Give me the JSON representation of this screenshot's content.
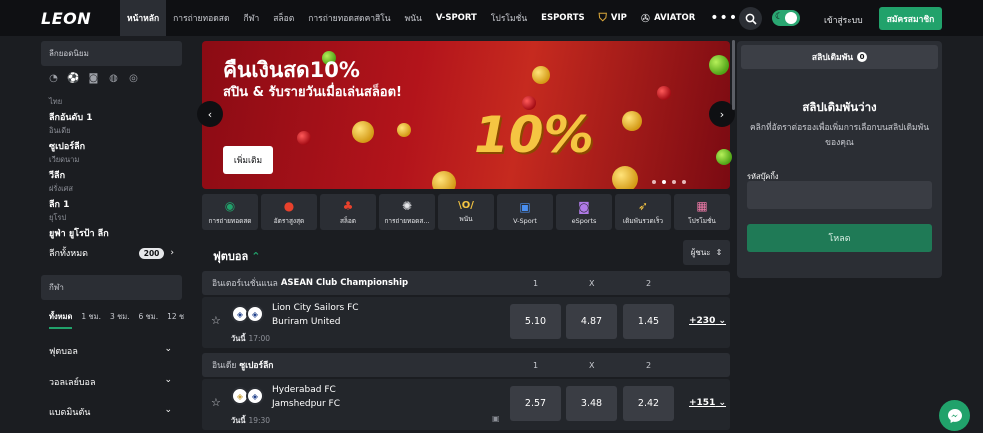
{
  "brand": {
    "logo": "LEON",
    "accent": "#21a26b"
  },
  "nav": {
    "items": [
      {
        "label": "หน้าหลัก"
      },
      {
        "label": "การถ่ายทอดสด"
      },
      {
        "label": "กีฬา"
      },
      {
        "label": "สล็อต"
      },
      {
        "label": "การถ่ายทอดสดคาสิโน"
      },
      {
        "label": "พนัน"
      },
      {
        "label": "V-SPORT"
      },
      {
        "label": "โปรโมชั่น"
      },
      {
        "label": "ESPORTS"
      },
      {
        "label": "VIP"
      },
      {
        "label": "AVIATOR"
      }
    ],
    "login": "เข้าสู่ระบบ",
    "signup": "สมัครสมาชิก"
  },
  "sidebar": {
    "popular_title": "ลีกยอดนิยม",
    "leagues": [
      {
        "country": "ไทย",
        "name": "ลีกอันดับ 1"
      },
      {
        "country": "อินเดีย",
        "name": "ซูเปอร์ลีก"
      },
      {
        "country": "เวียดนาม",
        "name": "วีลีก"
      },
      {
        "country": "ฝรั่งเศส",
        "name": "ลีก 1"
      },
      {
        "country": "ยุโรป",
        "name": "ยูฟ่า ยูโรป้า ลีก"
      }
    ],
    "all_leagues": "ลีกทั้งหมด",
    "all_leagues_count": "200",
    "sports_title": "กีฬา",
    "time_tabs": [
      "ทั้งหมด",
      "1 ชม.",
      "3 ชม.",
      "6 ชม.",
      "12 ช"
    ],
    "categories": [
      "ฟุตบอล",
      "วอลเลย์บอล",
      "แบดมินตัน"
    ]
  },
  "banner": {
    "title": "คืนเงินสด10%",
    "subtitle": "สปิน & รับรายวันเมื่อเล่นสล็อต!",
    "cta": "เพิ่มเติม",
    "big_text": "10%"
  },
  "categories": [
    {
      "label": "การถ่ายทอดสด",
      "icon": "play-circle-icon"
    },
    {
      "label": "อัตราสูงสุด",
      "icon": "boost-icon"
    },
    {
      "label": "สล็อต",
      "icon": "cherry-icon"
    },
    {
      "label": "การถ่ายทอดส...",
      "icon": "roulette-icon"
    },
    {
      "label": "พนัน",
      "icon": "vol-icon"
    },
    {
      "label": "V-Sport",
      "icon": "tv-icon"
    },
    {
      "label": "eSports",
      "icon": "gamepad-icon"
    },
    {
      "label": "เดิมพันรวดเร็ว",
      "icon": "rocket-icon"
    },
    {
      "label": "โปรโมชั่น",
      "icon": "gift-icon"
    }
  ],
  "main": {
    "sport_title": "ฟุตบอล",
    "sort_label": "ผู้ชนะ",
    "col_1": "1",
    "col_x": "X",
    "col_2": "2",
    "groups": [
      {
        "country": "อินเตอร์เนชั่นแนล",
        "league": "ASEAN Club Championship",
        "home": "Lion City Sailors FC",
        "away": "Buriram United",
        "day": "วันนี้",
        "time": "17:00",
        "odds": [
          "5.10",
          "4.87",
          "1.45"
        ],
        "more": "+230"
      },
      {
        "country": "อินเดีย",
        "league": "ซูเปอร์ลีก",
        "home": "Hyderabad FC",
        "away": "Jamshedpur FC",
        "day": "วันนี้",
        "time": "19:30",
        "odds": [
          "2.57",
          "3.48",
          "2.42"
        ],
        "more": "+151"
      }
    ]
  },
  "slip": {
    "tab": "สลิปเดิมพัน",
    "count": "0",
    "empty_title": "สลิปเดิมพันว่าง",
    "empty_desc": "คลิกที่อัตราต่อรองเพื่อเพิ่มการเลือกบนสลิปเดิมพันของคุณ",
    "code_label": "รหัสบุ๊คกิ้ง",
    "load_button": "โหลด"
  }
}
